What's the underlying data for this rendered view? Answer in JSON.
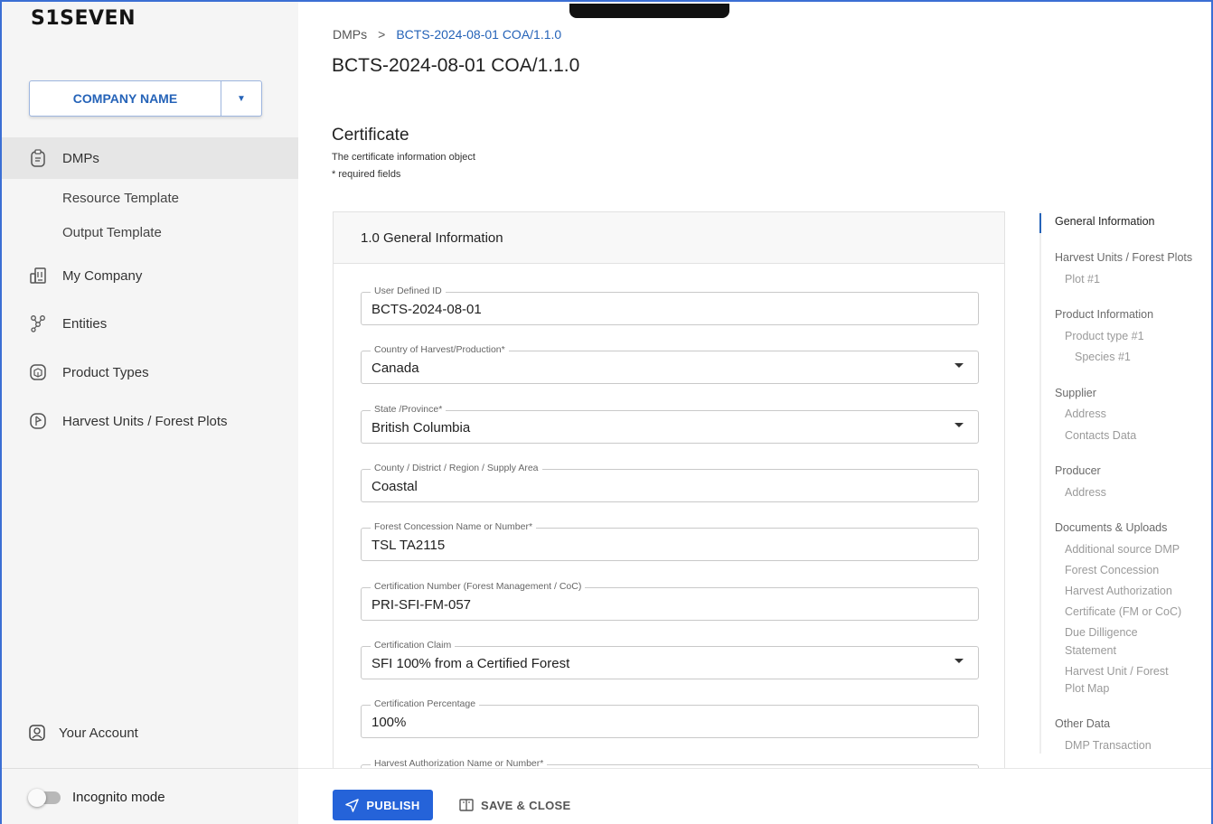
{
  "app": {
    "logo": "S1SEVEN",
    "company_selector": "COMPANY NAME"
  },
  "sidebar": {
    "items": [
      {
        "label": "DMPs",
        "icon": "clipboard-icon"
      },
      {
        "label": "Resource Template"
      },
      {
        "label": "Output Template"
      },
      {
        "label": "My Company",
        "icon": "building-icon"
      },
      {
        "label": "Entities",
        "icon": "network-icon"
      },
      {
        "label": "Product Types",
        "icon": "box-icon"
      },
      {
        "label": "Harvest Units / Forest Plots",
        "icon": "map-icon"
      }
    ],
    "account": "Your Account",
    "incognito": "Incognito mode"
  },
  "header": {
    "breadcrumb_root": "DMPs",
    "breadcrumb_sep": ">",
    "breadcrumb_current": "BCTS-2024-08-01 COA/1.1.0",
    "title": "BCTS-2024-08-01 COA/1.1.0"
  },
  "section": {
    "title": "Certificate",
    "description": "The certificate information object",
    "required_note": "* required fields",
    "card_title": "1.0 General Information"
  },
  "fields": [
    {
      "label": "User Defined ID",
      "value": "BCTS-2024-08-01"
    },
    {
      "label": "Country of Harvest/Production*",
      "value": "Canada"
    },
    {
      "label": "State /Province*",
      "value": "British Columbia"
    },
    {
      "label": "County / District / Region / Supply Area",
      "value": "Coastal"
    },
    {
      "label": "Forest Concession Name or Number*",
      "value": "TSL TA2115"
    },
    {
      "label": "Certification Number (Forest Management / CoC)",
      "value": "PRI-SFI-FM-057"
    },
    {
      "label": "Certification Claim",
      "value": "SFI 100% from a Certified Forest"
    },
    {
      "label": "Certification Percentage",
      "value": "100%"
    },
    {
      "label": "Harvest Authorization Name or Number*",
      "value": ""
    }
  ],
  "toc": [
    "General Information",
    "Harvest Units / Forest Plots",
    "Plot #1",
    "Product Information",
    "Product type #1",
    "Species #1",
    "Supplier",
    "Address",
    "Contacts Data",
    "Producer",
    "Address",
    "Documents & Uploads",
    "Additional source DMP",
    "Forest Concession",
    "Harvest Authorization",
    "Certificate (FM or CoC)",
    "Due Dilligence",
    "Statement",
    "Harvest Unit / Forest",
    "Plot Map",
    "Other Data",
    "DMP Transaction"
  ],
  "footer": {
    "publish": "PUBLISH",
    "save_close": "SAVE & CLOSE"
  },
  "colors": {
    "accent": "#2563b8",
    "primary_button": "#2563d9",
    "sidebar_bg": "#f5f5f5"
  }
}
